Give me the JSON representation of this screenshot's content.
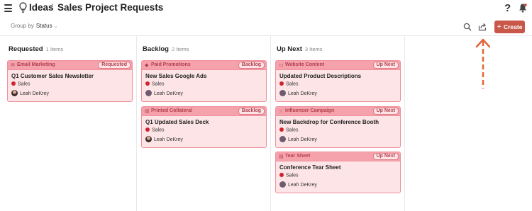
{
  "header": {
    "app": "Ideas",
    "separator": "/",
    "title": "Sales Project Requests",
    "help": "?"
  },
  "toolbar": {
    "group_by_label": "Group by",
    "group_by_value": "Status",
    "create_label": "Create",
    "create_plus": "+"
  },
  "columns": [
    {
      "title": "Requested",
      "count": "1 Items",
      "cards": [
        {
          "category": "Email Marketing",
          "category_icon": "envelope-icon",
          "status": "Requested",
          "title": "Q1 Customer Sales Newsletter",
          "tag": "Sales",
          "owner": "Leah DeKrey"
        }
      ]
    },
    {
      "title": "Backlog",
      "count": "2 Items",
      "cards": [
        {
          "category": "Paid Promotions",
          "category_icon": "tag-icon",
          "status": "Backlog",
          "title": "New Sales Google Ads",
          "tag": "Sales",
          "owner": "Leah DeKrey"
        },
        {
          "category": "Printed Collateral",
          "category_icon": "book-icon",
          "status": "Backlog",
          "title": "Q1 Updated Sales Deck",
          "tag": "Sales",
          "owner": "Leah DeKrey"
        }
      ]
    },
    {
      "title": "Up Next",
      "count": "3 Items",
      "cards": [
        {
          "category": "Website Content",
          "category_icon": "monitor-icon",
          "status": "Up Next",
          "title": "Updated Product Descriptions",
          "tag": "Sales",
          "owner": "Leah DeKrey"
        },
        {
          "category": "Influencer Campaign",
          "category_icon": "star-icon",
          "status": "Up Next",
          "title": "New Backdrop for Conference Booth",
          "tag": "Sales",
          "owner": "Leah DeKrey"
        },
        {
          "category": "Tear Sheet",
          "category_icon": "document-icon",
          "status": "Up Next",
          "title": "Conference Tear Sheet",
          "tag": "Sales",
          "owner": "Leah DeKrey"
        }
      ]
    }
  ],
  "colors": {
    "card_background": "#fde4e6",
    "card_border": "#f08f9a",
    "card_header": "#f6a2ac",
    "tag_dot": "#d0212f",
    "create_button": "#c8574a",
    "annotation_arrow": "#e0673a"
  }
}
